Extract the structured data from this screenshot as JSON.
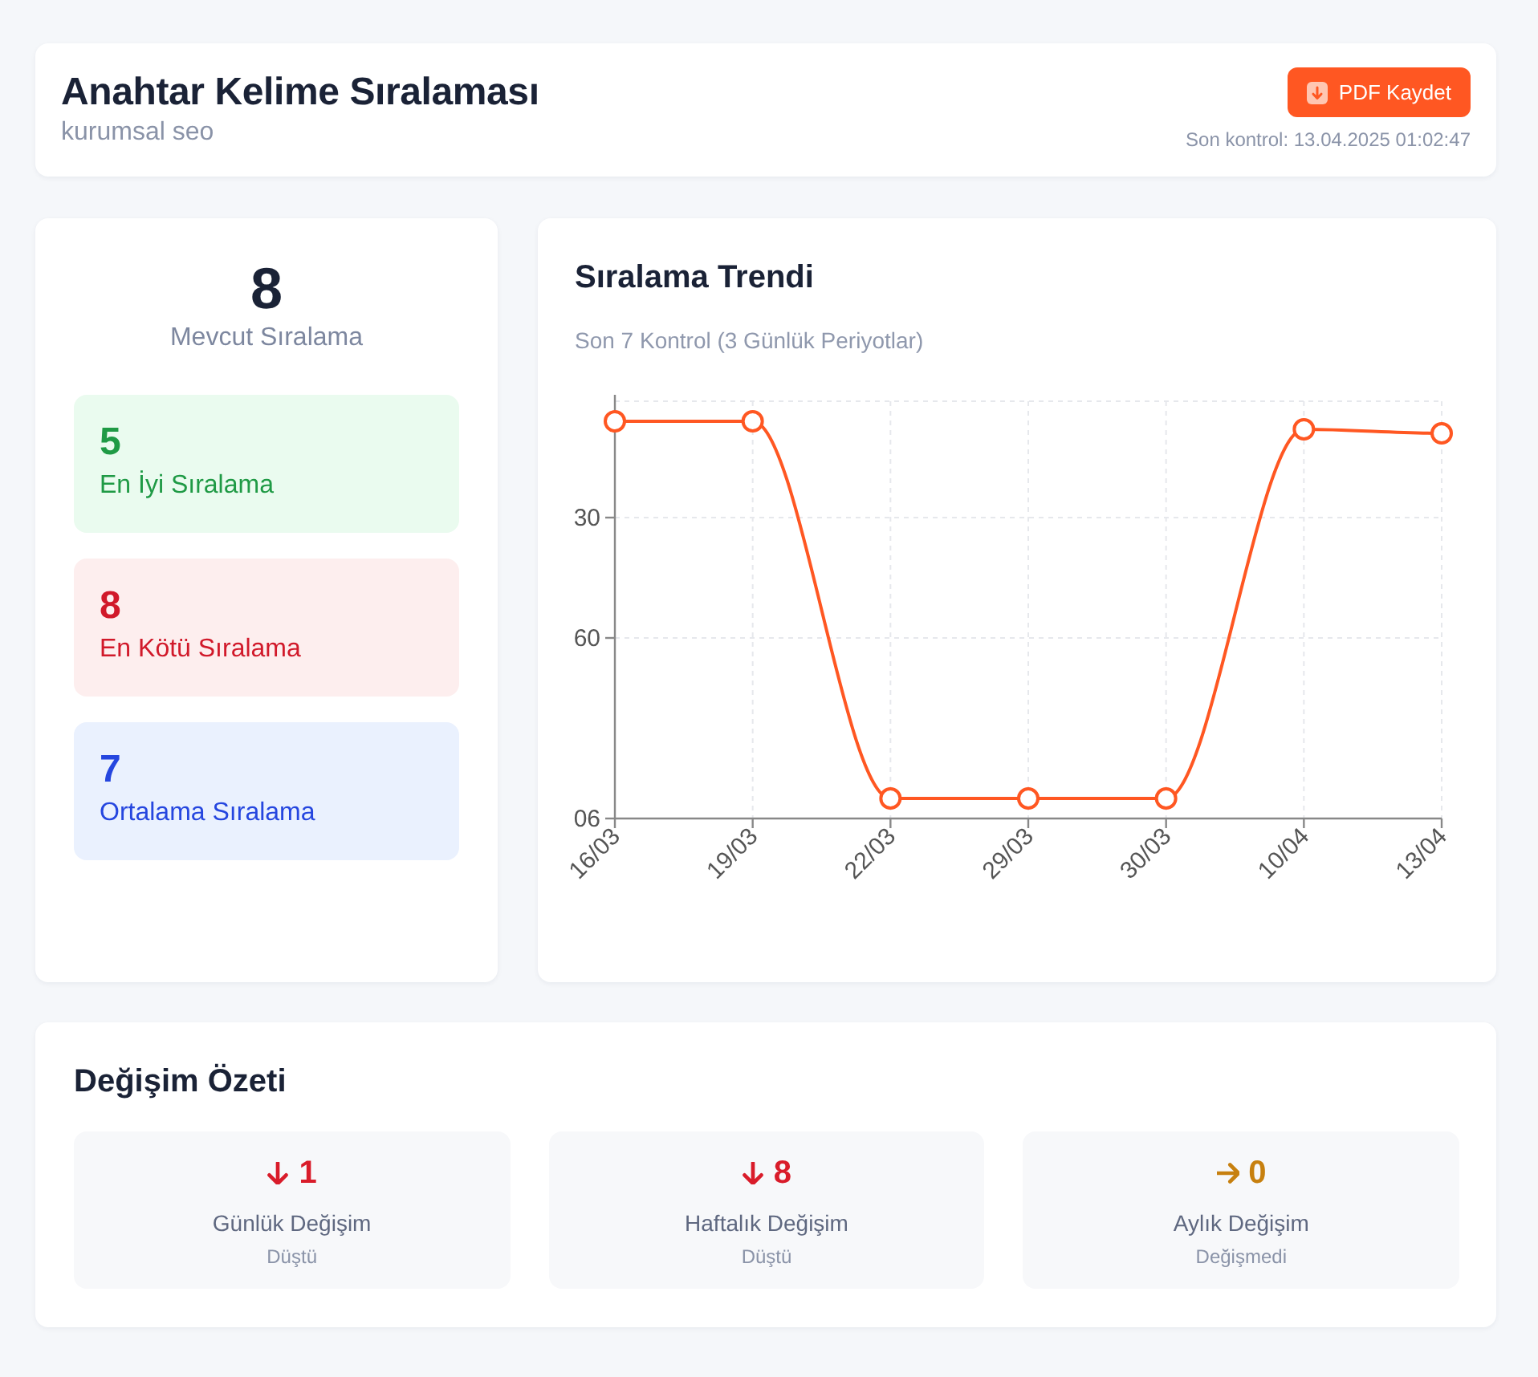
{
  "header": {
    "title": "Anahtar Kelime Sıralaması",
    "subtitle": "kurumsal seo",
    "button": "PDF Kaydet",
    "last_check": "Son kontrol: 13.04.2025 01:02:47"
  },
  "current": {
    "value": "8",
    "label": "Mevcut Sıralama"
  },
  "stats": [
    {
      "kind": "best",
      "value": "5",
      "label": "En İyi Sıralama"
    },
    {
      "kind": "worst",
      "value": "8",
      "label": "En Kötü Sıralama"
    },
    {
      "kind": "average",
      "value": "7",
      "label": "Ortalama Sıralama"
    }
  ],
  "trend": {
    "title": "Sıralama Trendi",
    "subtitle": "Son 7 Kontrol (3 Günlük Periyotlar)",
    "y_axis_end_label": "06",
    "chart_data": {
      "type": "line",
      "grid": true,
      "categories": [
        "16/03",
        "19/03",
        "22/03",
        "29/03",
        "30/03",
        "10/04",
        "13/04"
      ],
      "series": [
        {
          "color": "#ff5722",
          "marker": "circle",
          "values": [
            6,
            6,
            100,
            100,
            100,
            8,
            9
          ]
        }
      ],
      "ylim": [
        105,
        1
      ],
      "yticks": [
        30,
        60
      ]
    }
  },
  "changes": {
    "title": "Değişim Özeti",
    "items": [
      {
        "kind": "down",
        "value": "1",
        "label": "Günlük Değişim",
        "status": "Düştü"
      },
      {
        "kind": "down",
        "value": "8",
        "label": "Haftalık Değişim",
        "status": "Düştü"
      },
      {
        "kind": "flat",
        "value": "0",
        "label": "Aylık Değişim",
        "status": "Değişmedi"
      }
    ]
  }
}
